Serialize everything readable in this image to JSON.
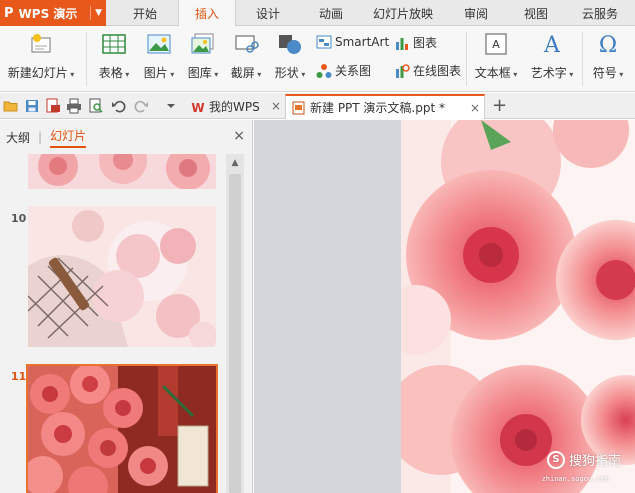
{
  "app": {
    "logo_text": "WPS 演示",
    "logo_glyph": "P",
    "accent": "#e8581a"
  },
  "menu": {
    "tabs": [
      {
        "label": "开始"
      },
      {
        "label": "插入"
      },
      {
        "label": "设计"
      },
      {
        "label": "动画"
      },
      {
        "label": "幻灯片放映"
      },
      {
        "label": "审阅"
      },
      {
        "label": "视图"
      },
      {
        "label": "云服务"
      }
    ],
    "active": "插入"
  },
  "ribbon": {
    "new_slide": "新建幻灯片",
    "table": "表格",
    "picture": "图片",
    "gallery": "图库",
    "screenshot": "截屏",
    "shapes": "形状",
    "smartart": "SmartArt",
    "relation": "关系图",
    "chart": "图表",
    "online_chart": "在线图表",
    "textbox": "文本框",
    "wordart": "艺术字",
    "symbol": "符号"
  },
  "quickbar": {
    "tabs": [
      {
        "label": "我的WPS",
        "icon": "wps-icon"
      },
      {
        "label": "新建 PPT 演示文稿.ppt *",
        "icon": "ppt-doc-icon",
        "active": true
      }
    ],
    "close_glyph": "×",
    "new_tab_glyph": "+"
  },
  "panel": {
    "outline_tab": "大纲",
    "separator": "|",
    "slides_tab": "幻灯片",
    "close_glyph": "×",
    "slides": [
      {
        "number": "",
        "image": "pink-roses-partial"
      },
      {
        "number": "10",
        "image": "pink-ribbon-basket"
      },
      {
        "number": "11",
        "image": "pink-roses-red-bucket",
        "selected": true
      }
    ]
  },
  "editor": {
    "slide_image": "pink-roses-closeup",
    "watermark": {
      "glyph": "S",
      "text": "搜狗指南",
      "url": "zhinan.sogou.com"
    }
  }
}
